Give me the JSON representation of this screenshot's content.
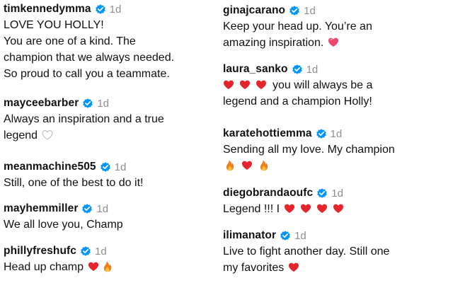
{
  "left_comments": [
    {
      "username": "timkennedymma",
      "time": "1d",
      "lines": [
        "LOVE YOU HOLLY!",
        "You are one of a kind. The",
        "champion that we always needed.",
        "So proud to call you a teammate."
      ]
    },
    {
      "username": "mayceebarber",
      "time": "1d",
      "lines": [
        "Always an inspiration and a true",
        "legend"
      ],
      "trailing_emojis": [
        "white-heart"
      ]
    },
    {
      "username": "meanmachine505",
      "time": "1d",
      "lines": [
        "Still, one of the best to do it!"
      ]
    },
    {
      "username": "mayhemmiller",
      "time": "1d",
      "lines": [
        "We all love you, Champ"
      ]
    },
    {
      "username": "phillyfreshufc",
      "time": "1d",
      "lines": [
        "Head up champ"
      ],
      "trailing_emojis": [
        "red-heart",
        "fire"
      ]
    }
  ],
  "right_comments": [
    {
      "username": "ginajcarano",
      "time": "1d",
      "lines": [
        "Keep your head up. You’re an",
        "amazing inspiration."
      ],
      "trailing_emojis": [
        "pink-heart"
      ]
    },
    {
      "username": "laura_sanko",
      "time": "1d",
      "leading_emojis": [
        "red-heart",
        "red-heart",
        "red-heart"
      ],
      "lines": [
        "you will always be a",
        "legend and a champion Holly!"
      ]
    },
    {
      "username": "karatehottiemma",
      "time": "1d",
      "lines": [
        "Sending all my love. My champion"
      ],
      "emoji_line": [
        "fire",
        "red-heart",
        "fire"
      ]
    },
    {
      "username": "diegobrandaoufc",
      "time": "1d",
      "lines": [
        "Legend !!! I"
      ],
      "trailing_emojis": [
        "red-heart",
        "red-heart",
        "red-heart",
        "red-heart"
      ]
    },
    {
      "username": "ilimanator",
      "time": "1d",
      "lines": [
        "Live to fight another day. Still one",
        "my favorites"
      ],
      "trailing_emojis": [
        "red-heart"
      ]
    }
  ],
  "colors": {
    "verified_badge": "#0095f6",
    "timestamp": "#8e8e8e",
    "red_heart": "#e5242b",
    "pink_heart": "#f0466e",
    "fire_outer": "#f37b1d",
    "fire_inner": "#fdc43b"
  }
}
